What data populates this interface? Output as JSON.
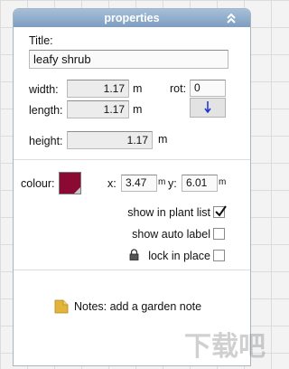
{
  "panel": {
    "title": "properties",
    "title_label": "Title:",
    "title_value": "leafy shrub",
    "width_label": "width:",
    "width_value": "1.17",
    "width_unit": "m",
    "length_label": "length:",
    "length_value": "1.17",
    "length_unit": "m",
    "rot_label": "rot:",
    "rot_value": "0",
    "height_label": "height:",
    "height_value": "1.17",
    "height_unit": "m",
    "colour_label": "colour:",
    "colour_hex": "#8b0a33",
    "x_label": "x:",
    "x_value": "3.47",
    "x_unit": "m",
    "y_label": "y:",
    "y_value": "6.01",
    "y_unit": "m",
    "show_in_plant_list_label": "show in plant list",
    "show_in_plant_list_checked": true,
    "show_auto_label_label": "show auto label",
    "show_auto_label_checked": false,
    "lock_in_place_label": "lock in place",
    "lock_in_place_checked": false,
    "notes_label": "Notes: add a garden note"
  },
  "watermark": "下载吧"
}
